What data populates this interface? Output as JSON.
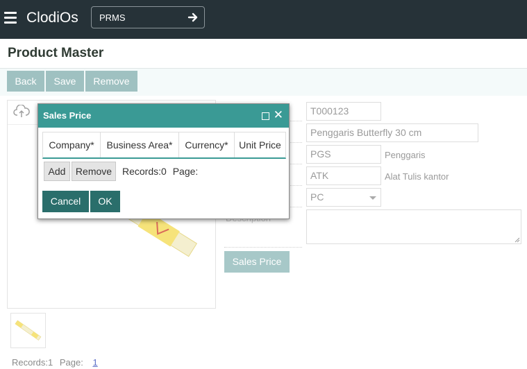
{
  "app": {
    "brand": "ClodiOs",
    "app_selector": "PRMS"
  },
  "page": {
    "title": "Product Master"
  },
  "toolbar": {
    "back": "Back",
    "save": "Save",
    "remove": "Remove"
  },
  "form": {
    "code": "T000123",
    "name": "Penggaris Butterfly 30 cm",
    "group_code": "PGS",
    "group_name": "Penggaris",
    "category_code": "ATK",
    "category_name": "Alat Tulis kantor",
    "uom": "PC",
    "description_label": "Description",
    "sales_price_button": "Sales Price"
  },
  "images": {
    "records_label": "Records:1",
    "page_label": "Page:",
    "page_number": "1"
  },
  "dialog": {
    "title": "Sales Price",
    "columns": [
      "Company*",
      "Business Area*",
      "Currency*",
      "Unit Price"
    ],
    "add": "Add",
    "remove": "Remove",
    "records": "Records:0",
    "page": "Page:",
    "cancel": "Cancel",
    "ok": "OK"
  },
  "colors": {
    "topbar": "#263238",
    "dialog_header": "#3a9a95",
    "primary_button": "#2a6e6b",
    "toolbar_button": "#9fc1c1"
  },
  "icons": [
    "menu-icon",
    "arrow-right-icon",
    "cloud-upload-icon",
    "maximize-icon",
    "close-icon",
    "dropdown-caret-icon"
  ]
}
